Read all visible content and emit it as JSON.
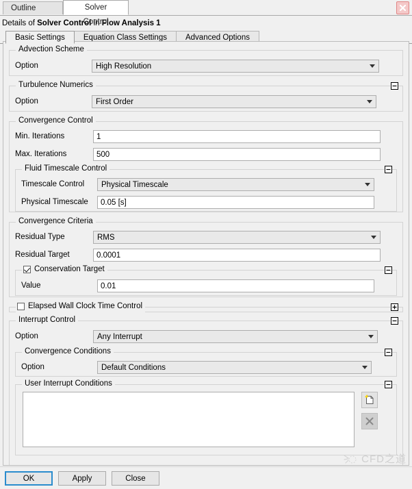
{
  "window": {
    "tabs": [
      {
        "label": "Outline",
        "active": false
      },
      {
        "label": "Solver Control",
        "active": true
      }
    ],
    "close_icon": "close-icon"
  },
  "details": {
    "prefix": "Details of ",
    "object": "Solver Control",
    "middle": " in ",
    "context": "Flow Analysis 1"
  },
  "inner_tabs": [
    {
      "label": "Basic Settings",
      "active": true
    },
    {
      "label": "Equation Class Settings",
      "active": false
    },
    {
      "label": "Advanced Options",
      "active": false
    }
  ],
  "sections": {
    "advection_scheme": {
      "title": "Advection Scheme",
      "option_label": "Option",
      "option_value": "High Resolution"
    },
    "turbulence_numerics": {
      "title": "Turbulence Numerics",
      "collapse_state": "minus",
      "option_label": "Option",
      "option_value": "First Order"
    },
    "convergence_control": {
      "title": "Convergence Control",
      "min_iterations_label": "Min. Iterations",
      "min_iterations_value": "1",
      "max_iterations_label": "Max. Iterations",
      "max_iterations_value": "500",
      "fluid_timescale": {
        "title": "Fluid Timescale Control",
        "collapse_state": "minus",
        "timescale_control_label": "Timescale Control",
        "timescale_control_value": "Physical Timescale",
        "physical_timescale_label": "Physical Timescale",
        "physical_timescale_value": "0.05 [s]"
      }
    },
    "convergence_criteria": {
      "title": "Convergence Criteria",
      "residual_type_label": "Residual Type",
      "residual_type_value": "RMS",
      "residual_target_label": "Residual Target",
      "residual_target_value": "0.0001",
      "conservation_target": {
        "title": "Conservation Target",
        "checked": true,
        "collapse_state": "minus",
        "value_label": "Value",
        "value": "0.01"
      }
    },
    "elapsed_wall_clock": {
      "title": "Elapsed Wall Clock Time Control",
      "checked": false,
      "collapse_state": "plus"
    },
    "interrupt_control": {
      "title": "Interrupt Control",
      "collapse_state": "minus",
      "option_label": "Option",
      "option_value": "Any Interrupt",
      "convergence_conditions": {
        "title": "Convergence Conditions",
        "collapse_state": "minus",
        "option_label": "Option",
        "option_value": "Default Conditions"
      },
      "user_interrupt_conditions": {
        "title": "User Interrupt Conditions",
        "collapse_state": "minus",
        "list_value": "",
        "new_button_icon": "new-document-icon",
        "delete_button_icon": "delete-x-icon"
      }
    }
  },
  "buttons": {
    "ok": "OK",
    "apply": "Apply",
    "close": "Close"
  },
  "watermark": {
    "text": "CFD之道",
    "icon": "watermark-logo-icon"
  }
}
